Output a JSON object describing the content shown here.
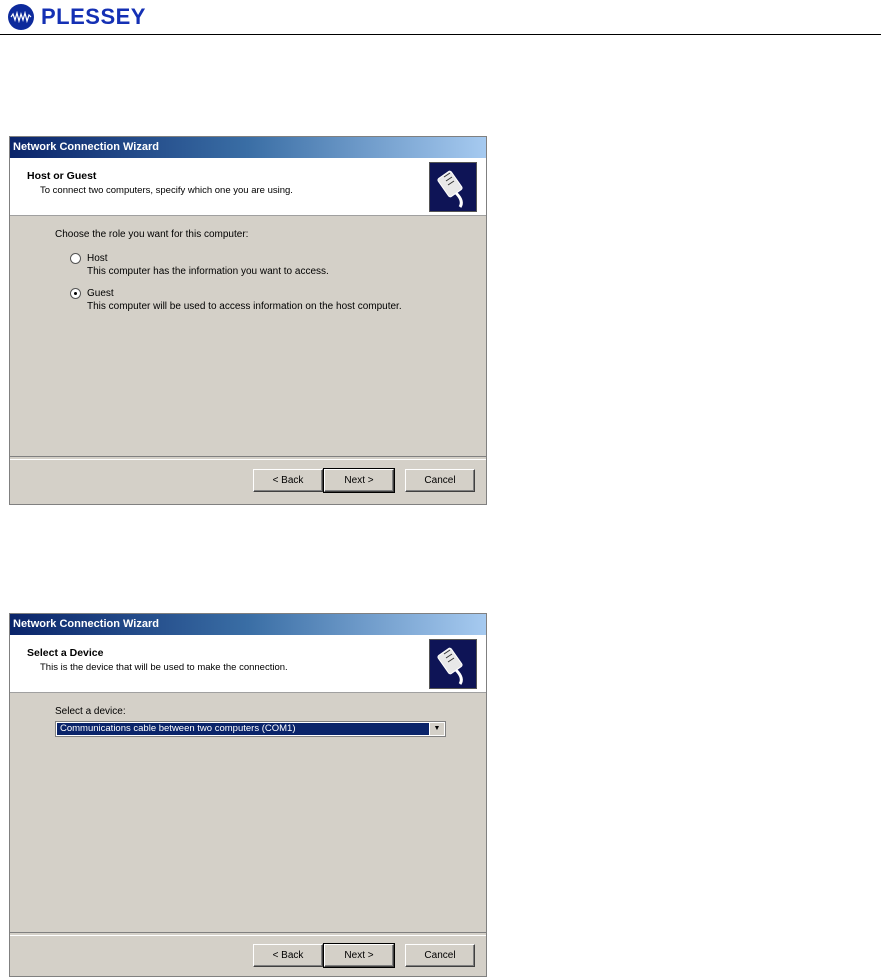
{
  "header": {
    "brand": "PLESSEY",
    "logo_text": "plessey"
  },
  "wizard1": {
    "title": "Network Connection Wizard",
    "banner_title": "Host or Guest",
    "banner_subtitle": "To connect two computers, specify which one you are using.",
    "prompt": "Choose the role you want for this computer:",
    "options": [
      {
        "label": "Host",
        "description": "This computer has the information you want to access.",
        "selected": false
      },
      {
        "label": "Guest",
        "description": "This computer will be used to access information on the host computer.",
        "selected": true
      }
    ],
    "buttons": {
      "back": "< Back",
      "next": "Next >",
      "cancel": "Cancel"
    }
  },
  "wizard2": {
    "title": "Network Connection Wizard",
    "banner_title": "Select a Device",
    "banner_subtitle": "This is the device that will be used to make the connection.",
    "prompt": "Select a device:",
    "device_select": {
      "value": "Communications cable between two computers (COM1)"
    },
    "buttons": {
      "back": "< Back",
      "next": "Next >",
      "cancel": "Cancel"
    }
  },
  "colors": {
    "brand": "#1430b4",
    "titlebar": "#0a246a",
    "dialog": "#d4d0c8"
  }
}
